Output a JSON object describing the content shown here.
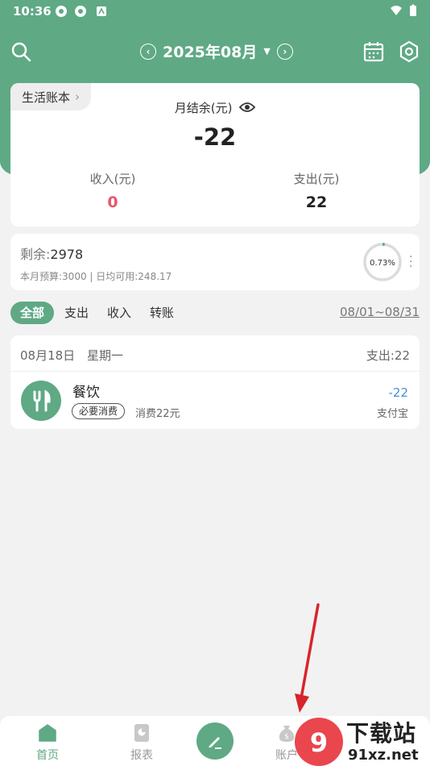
{
  "status_bar": {
    "time": "10:36"
  },
  "header": {
    "month": "2025年08月"
  },
  "summary": {
    "book_name": "生活账本",
    "balance_label": "月结余(元)",
    "balance_value": "-22",
    "income_label": "收入(元)",
    "income_value": "0",
    "expense_label": "支出(元)",
    "expense_value": "22"
  },
  "budget": {
    "remaining_label": "剩余:",
    "remaining_value": "2978",
    "detail": "本月预算:3000 | 日均可用:248.17",
    "percent_text": "0.73%",
    "percent": 0.0073
  },
  "filters": {
    "items": [
      "全部",
      "支出",
      "收入",
      "转账"
    ],
    "active": "全部",
    "date_range": "08/01~08/31"
  },
  "day_group": {
    "date": "08月18日",
    "weekday": "星期一",
    "total": "支出:22",
    "transaction": {
      "category": "餐饮",
      "tag": "必要消费",
      "note": "消费22元",
      "amount": "-22",
      "account": "支付宝"
    }
  },
  "tabbar": {
    "home": "首页",
    "report": "报表",
    "account": "账户"
  },
  "watermark": {
    "text": "下载站",
    "site": "91xz.net"
  },
  "colors": {
    "accent": "#5fa985",
    "income": "#e6566e",
    "expense_amount": "#4a8fd6",
    "arrow": "#d9232b"
  }
}
